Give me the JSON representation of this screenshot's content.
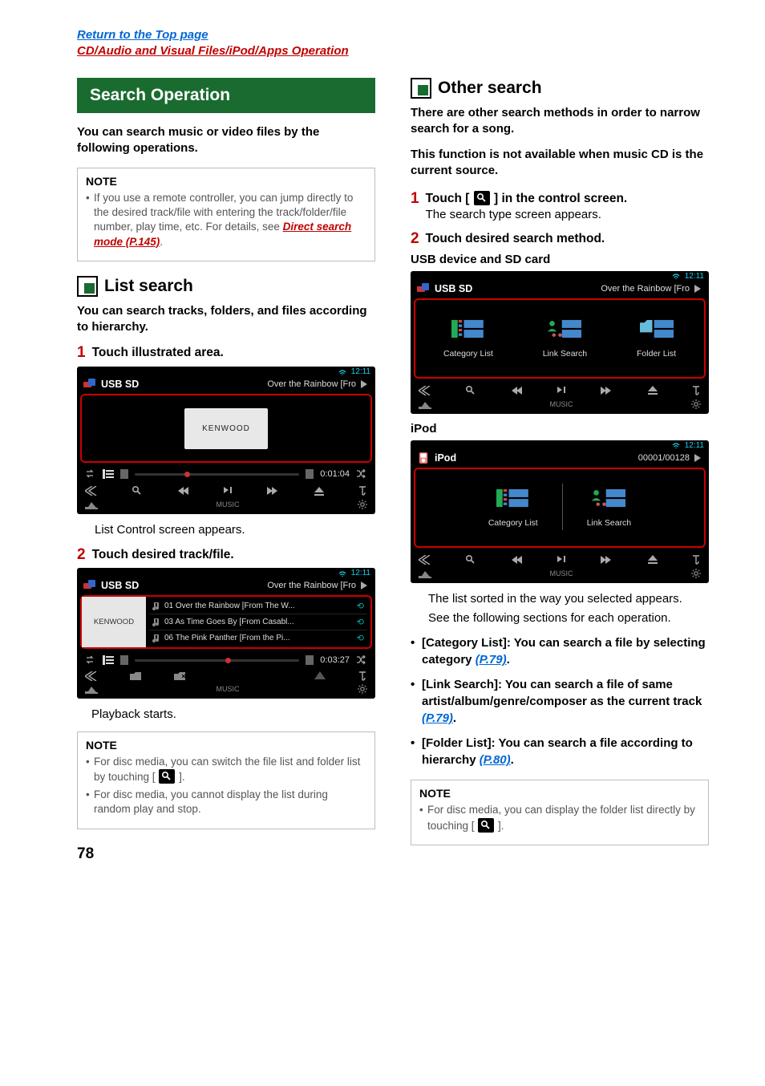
{
  "top_links": {
    "return": "Return to the Top page",
    "breadcrumb": "CD/Audio and Visual Files/iPod/Apps Operation"
  },
  "page_number": "78",
  "left": {
    "green_title": "Search Operation",
    "intro": "You can search music or video files by the following operations.",
    "note1_title": "NOTE",
    "note1_item": "If you use a remote controller, you can jump directly to the desired track/file with entering the track/folder/file number, play time, etc. For details, see ",
    "note1_link": "Direct search mode (P.145)",
    "note1_after": ".",
    "list_search_title": "List search",
    "list_search_intro": "You can search tracks, folders, and files according to hierarchy.",
    "step1": "Touch illustrated area.",
    "ss1": {
      "clock": "12:11",
      "source": "USB SD",
      "now_playing": "Over the Rainbow [Fro",
      "center": "KENWOOD",
      "time": "0:01:04",
      "bottom_label": "MUSIC"
    },
    "after_ss1": "List Control screen appears.",
    "step2": "Touch desired track/file.",
    "ss2": {
      "clock": "12:11",
      "source": "USB SD",
      "now_playing": "Over the Rainbow [Fro",
      "kw": "KENWOOD",
      "tracks": [
        "01 Over the Rainbow [From The W...",
        "03 As Time Goes By [From Casabl...",
        "06 The Pink Panther [From the Pi..."
      ],
      "time": "0:03:27",
      "bottom_label": "MUSIC"
    },
    "after_ss2": "Playback starts.",
    "note2_title": "NOTE",
    "note2_items": [
      "For disc media, you can switch the file list and folder list by touching [ @ICON@ ].",
      "For disc media, you cannot display the list during random play and stop."
    ]
  },
  "right": {
    "other_search_title": "Other search",
    "intro1": "There are other search methods in order to narrow search for a song.",
    "intro2": "This function is not available when music CD is the current source.",
    "step1_a": "Touch [ ",
    "step1_b": " ] in the control screen.",
    "step1_result": "The search type screen appears.",
    "step2": "Touch desired search method.",
    "caption_usb": "USB device and SD card",
    "ss_usb": {
      "clock": "12:11",
      "source": "USB SD",
      "now_playing": "Over the Rainbow [Fro",
      "cats": [
        "Category List",
        "Link Search",
        "Folder List"
      ],
      "bottom_label": "MUSIC"
    },
    "caption_ipod": "iPod",
    "ss_ipod": {
      "clock": "12:11",
      "source": "iPod",
      "now_playing": "00001/00128",
      "cats": [
        "Category List",
        "Link Search"
      ],
      "bottom_label": "MUSIC"
    },
    "result1": "The list sorted in the way you selected appears.",
    "result2": "See the following sections for each operation.",
    "bullets": [
      {
        "pre": "[Category List]: You can search a file by selecting category ",
        "pg": "(P.79)",
        "post": "."
      },
      {
        "pre": "[Link Search]: You can search a file of same artist/album/genre/composer as the current track ",
        "pg": "(P.79)",
        "post": "."
      },
      {
        "pre": "[Folder List]: You can search a file according to hierarchy ",
        "pg": "(P.80)",
        "post": "."
      }
    ],
    "note_title": "NOTE",
    "note_item": "For disc media, you can display the folder list directly by touching [ @ICON@ ]."
  }
}
